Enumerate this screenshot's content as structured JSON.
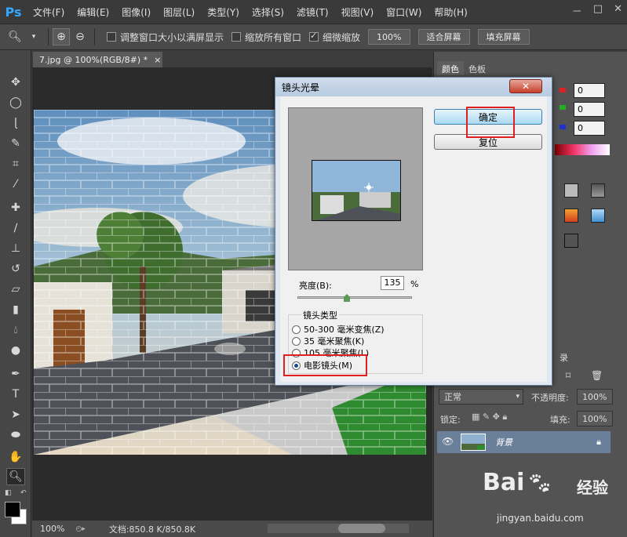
{
  "app": {
    "logo": "Ps"
  },
  "menu": [
    "文件(F)",
    "编辑(E)",
    "图像(I)",
    "图层(L)",
    "类型(Y)",
    "选择(S)",
    "滤镜(T)",
    "视图(V)",
    "窗口(W)",
    "帮助(H)"
  ],
  "window_controls": [
    "－",
    "□",
    "✕"
  ],
  "options": {
    "resize_windows": "调整窗口大小以满屏显示",
    "zoom_all_windows": "缩放所有窗口",
    "scrubby_zoom": "细微缩放",
    "zoom_100": "100%",
    "fit_screen": "适合屏幕",
    "fill_screen": "填充屏幕"
  },
  "document": {
    "tab_title": "7.jpg @ 100%(RGB/8#) *",
    "tab_close": "×",
    "zoom": "100%",
    "doc_info": "文档:850.8 K/850.8K"
  },
  "panels": {
    "color_tab": "颜色",
    "swatches_tab": "色板",
    "r_value": "0",
    "g_value": "0",
    "b_value": "0",
    "layers_tab_fragment": "录",
    "blend_mode": "正常",
    "opacity_label": "不透明度:",
    "opacity_value": "100%",
    "lock_label": "锁定:",
    "fill_label": "填充:",
    "fill_value": "100%",
    "layer_name": "背景"
  },
  "dialog": {
    "title": "镜头光晕",
    "ok": "确定",
    "reset": "复位",
    "brightness_label": "亮度(B):",
    "brightness_value": "135",
    "percent": "%",
    "lens_type_label": "镜头类型",
    "lens_options": [
      "50-300 毫米变焦(Z)",
      "35 毫米聚焦(K)",
      "105 毫米聚焦(L)",
      "电影镜头(M)"
    ],
    "selected_lens": "电影镜头(M)"
  },
  "watermark": {
    "brand": "Bai",
    "brand2": "经验",
    "url": "jingyan.baidu.com"
  },
  "colors": {
    "accent_red": "#e02020",
    "ui_dark": "#3c3c3c",
    "dialog_bg": "#f0f0f0"
  }
}
